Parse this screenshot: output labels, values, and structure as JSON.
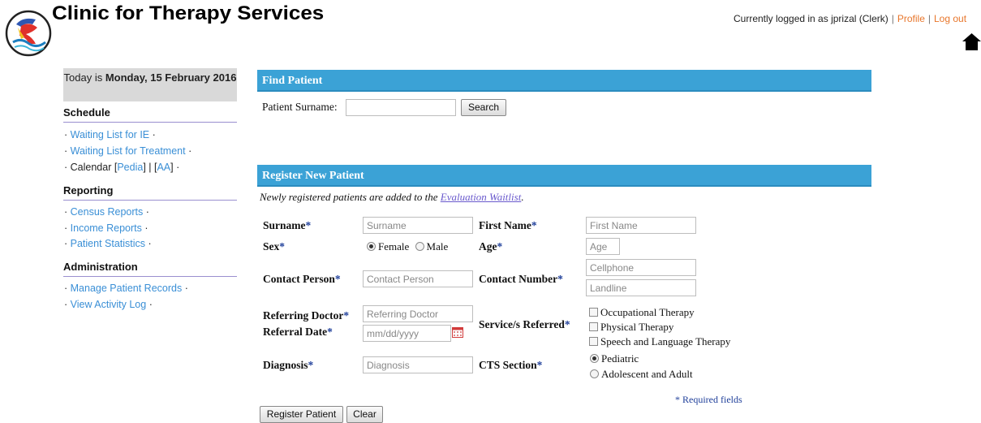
{
  "header": {
    "title": "Clinic for Therapy Services",
    "user_text": "Currently logged in as jprizal (Clerk)",
    "profile_link": "Profile",
    "logout_link": "Log out",
    "home_icon": "home-icon",
    "logo": "clinic-logo-icon"
  },
  "sidebar": {
    "today_prefix": "Today is ",
    "today_date": "Monday, 15 February 2016",
    "schedule_heading": "Schedule",
    "waiting_ie": "Waiting List for IE",
    "waiting_treatment": "Waiting List for Treatment",
    "calendar_label": "Calendar",
    "calendar_pedia": "Pedia",
    "calendar_aa": "AA",
    "reporting_heading": "Reporting",
    "census_reports": "Census Reports",
    "income_reports": "Income Reports",
    "patient_statistics": "Patient Statistics",
    "administration_heading": "Administration",
    "manage_records": "Manage Patient Records",
    "activity_log": "View Activity Log"
  },
  "find_patient": {
    "heading": "Find Patient",
    "surname_label": "Patient Surname:",
    "surname_value": "",
    "search_button": "Search"
  },
  "register": {
    "heading": "Register New Patient",
    "note_prefix": "Newly registered patients are added to the ",
    "note_link": "Evaluation Waitlist",
    "note_suffix": ".",
    "surname_label": "Surname",
    "surname_placeholder": "Surname",
    "first_name_label": "First Name",
    "first_name_placeholder": "First Name",
    "sex_label": "Sex",
    "sex_female": "Female",
    "sex_male": "Male",
    "sex_selected": "Female",
    "age_label": "Age",
    "age_placeholder": "Age",
    "contact_person_label": "Contact Person",
    "contact_person_placeholder": "Contact Person",
    "contact_number_label": "Contact Number",
    "cellphone_placeholder": "Cellphone",
    "landline_placeholder": "Landline",
    "referring_doctor_label": "Referring Doctor",
    "referring_doctor_placeholder": "Referring Doctor",
    "referral_date_label": "Referral Date",
    "referral_date_placeholder": "mm/dd/yyyy",
    "services_label": "Service/s Referred",
    "service_ot": "Occupational Therapy",
    "service_pt": "Physical Therapy",
    "service_slt": "Speech and Language Therapy",
    "diagnosis_label": "Diagnosis",
    "diagnosis_placeholder": "Diagnosis",
    "cts_section_label": "CTS Section",
    "cts_pediatric": "Pediatric",
    "cts_adult": "Adolescent and Adult",
    "cts_selected": "Pediatric",
    "required_note": "* Required fields",
    "register_button": "Register Patient",
    "clear_button": "Clear",
    "asterisk": "*"
  },
  "colors": {
    "panel_bar": "#3ba2d6",
    "link_blue": "#3a8fd6",
    "header_link": "#e8762b",
    "required_blue": "#1f3f9a"
  }
}
